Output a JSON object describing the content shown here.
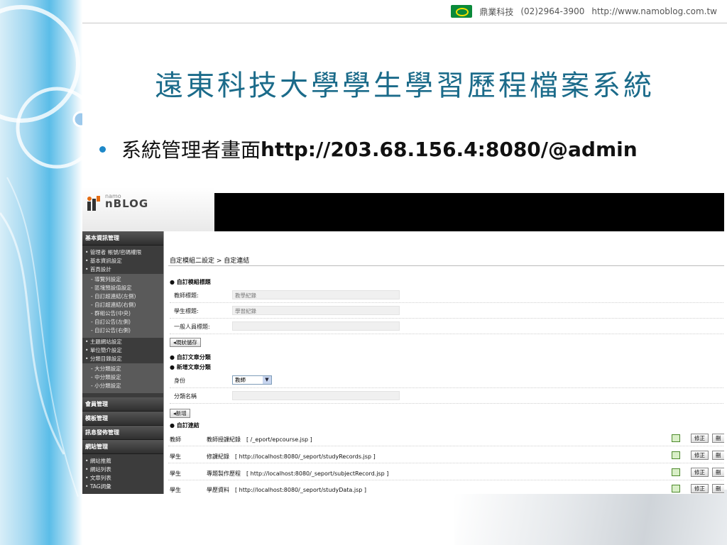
{
  "header": {
    "company": "鼎業科技",
    "phone": "(02)2964-3900",
    "url": "http://www.namoblog.com.tw"
  },
  "slide": {
    "title": "遠東科技大學學生學習歷程檔案系統",
    "bullet_text": "系統管理者畫面",
    "bullet_url": "http://203.68.156.4:8080/@admin"
  },
  "app": {
    "logo_small": "namo",
    "logo_text": "nBLOG",
    "sidebar": {
      "head1": "基本資訊管理",
      "group1": [
        "管理者 帳號/密碼權限",
        "基本資訊設定",
        "首頁設計"
      ],
      "sub1": [
        "導覽列設定",
        "區塊預設值設定",
        "自訂超連結(左側)",
        "自訂超連結(右側)",
        "群組公告(中央)",
        "自訂公告(左側)",
        "自訂公告(右側)"
      ],
      "group2": [
        "主題網站設定",
        "單位簡介設定",
        "分類目錄設定"
      ],
      "sub2": [
        "大分類設定",
        "中分類設定",
        "小分類設定"
      ],
      "head2": "會員管理",
      "head3": "模板管理",
      "head4": "訊息發佈管理",
      "head5": "網站管理",
      "group3": [
        "網站推薦",
        "網站列表",
        "文章列表",
        "TAG詞彙"
      ]
    },
    "main": {
      "breadcrumb": "自定模組二設定 > 自定連結",
      "section_custom_title": "自訂模組標題",
      "fields": [
        {
          "label": "教師標題:",
          "value": "教學紀錄"
        },
        {
          "label": "學生標題:",
          "value": "學習紀錄"
        },
        {
          "label": "一般人員標題:",
          "value": ""
        }
      ],
      "save_button": "現狀儲存",
      "section_article_cat": "自訂文章分類",
      "section_new_cat": "新增文章分類",
      "role_label": "身份",
      "role_selected": "教師",
      "category_label": "分類名稱",
      "add_button": "新增",
      "section_links": "自訂連結",
      "links": [
        {
          "role": "教師",
          "name": "教師授課紀錄",
          "url": "[ /_eport/epcourse.jsp ]"
        },
        {
          "role": "學生",
          "name": "修課紀錄",
          "url": "[ http://localhost:8080/_seport/studyRecords.jsp ]"
        },
        {
          "role": "學生",
          "name": "專題製作歷程",
          "url": "[ http://localhost:8080/_seport/subjectRecord.jsp ]"
        },
        {
          "role": "學生",
          "name": "學歷資料",
          "url": "[ http://localhost:8080/_seport/studyData.jsp ]"
        }
      ],
      "edit_label": "修正",
      "delete_label": "刪"
    }
  }
}
